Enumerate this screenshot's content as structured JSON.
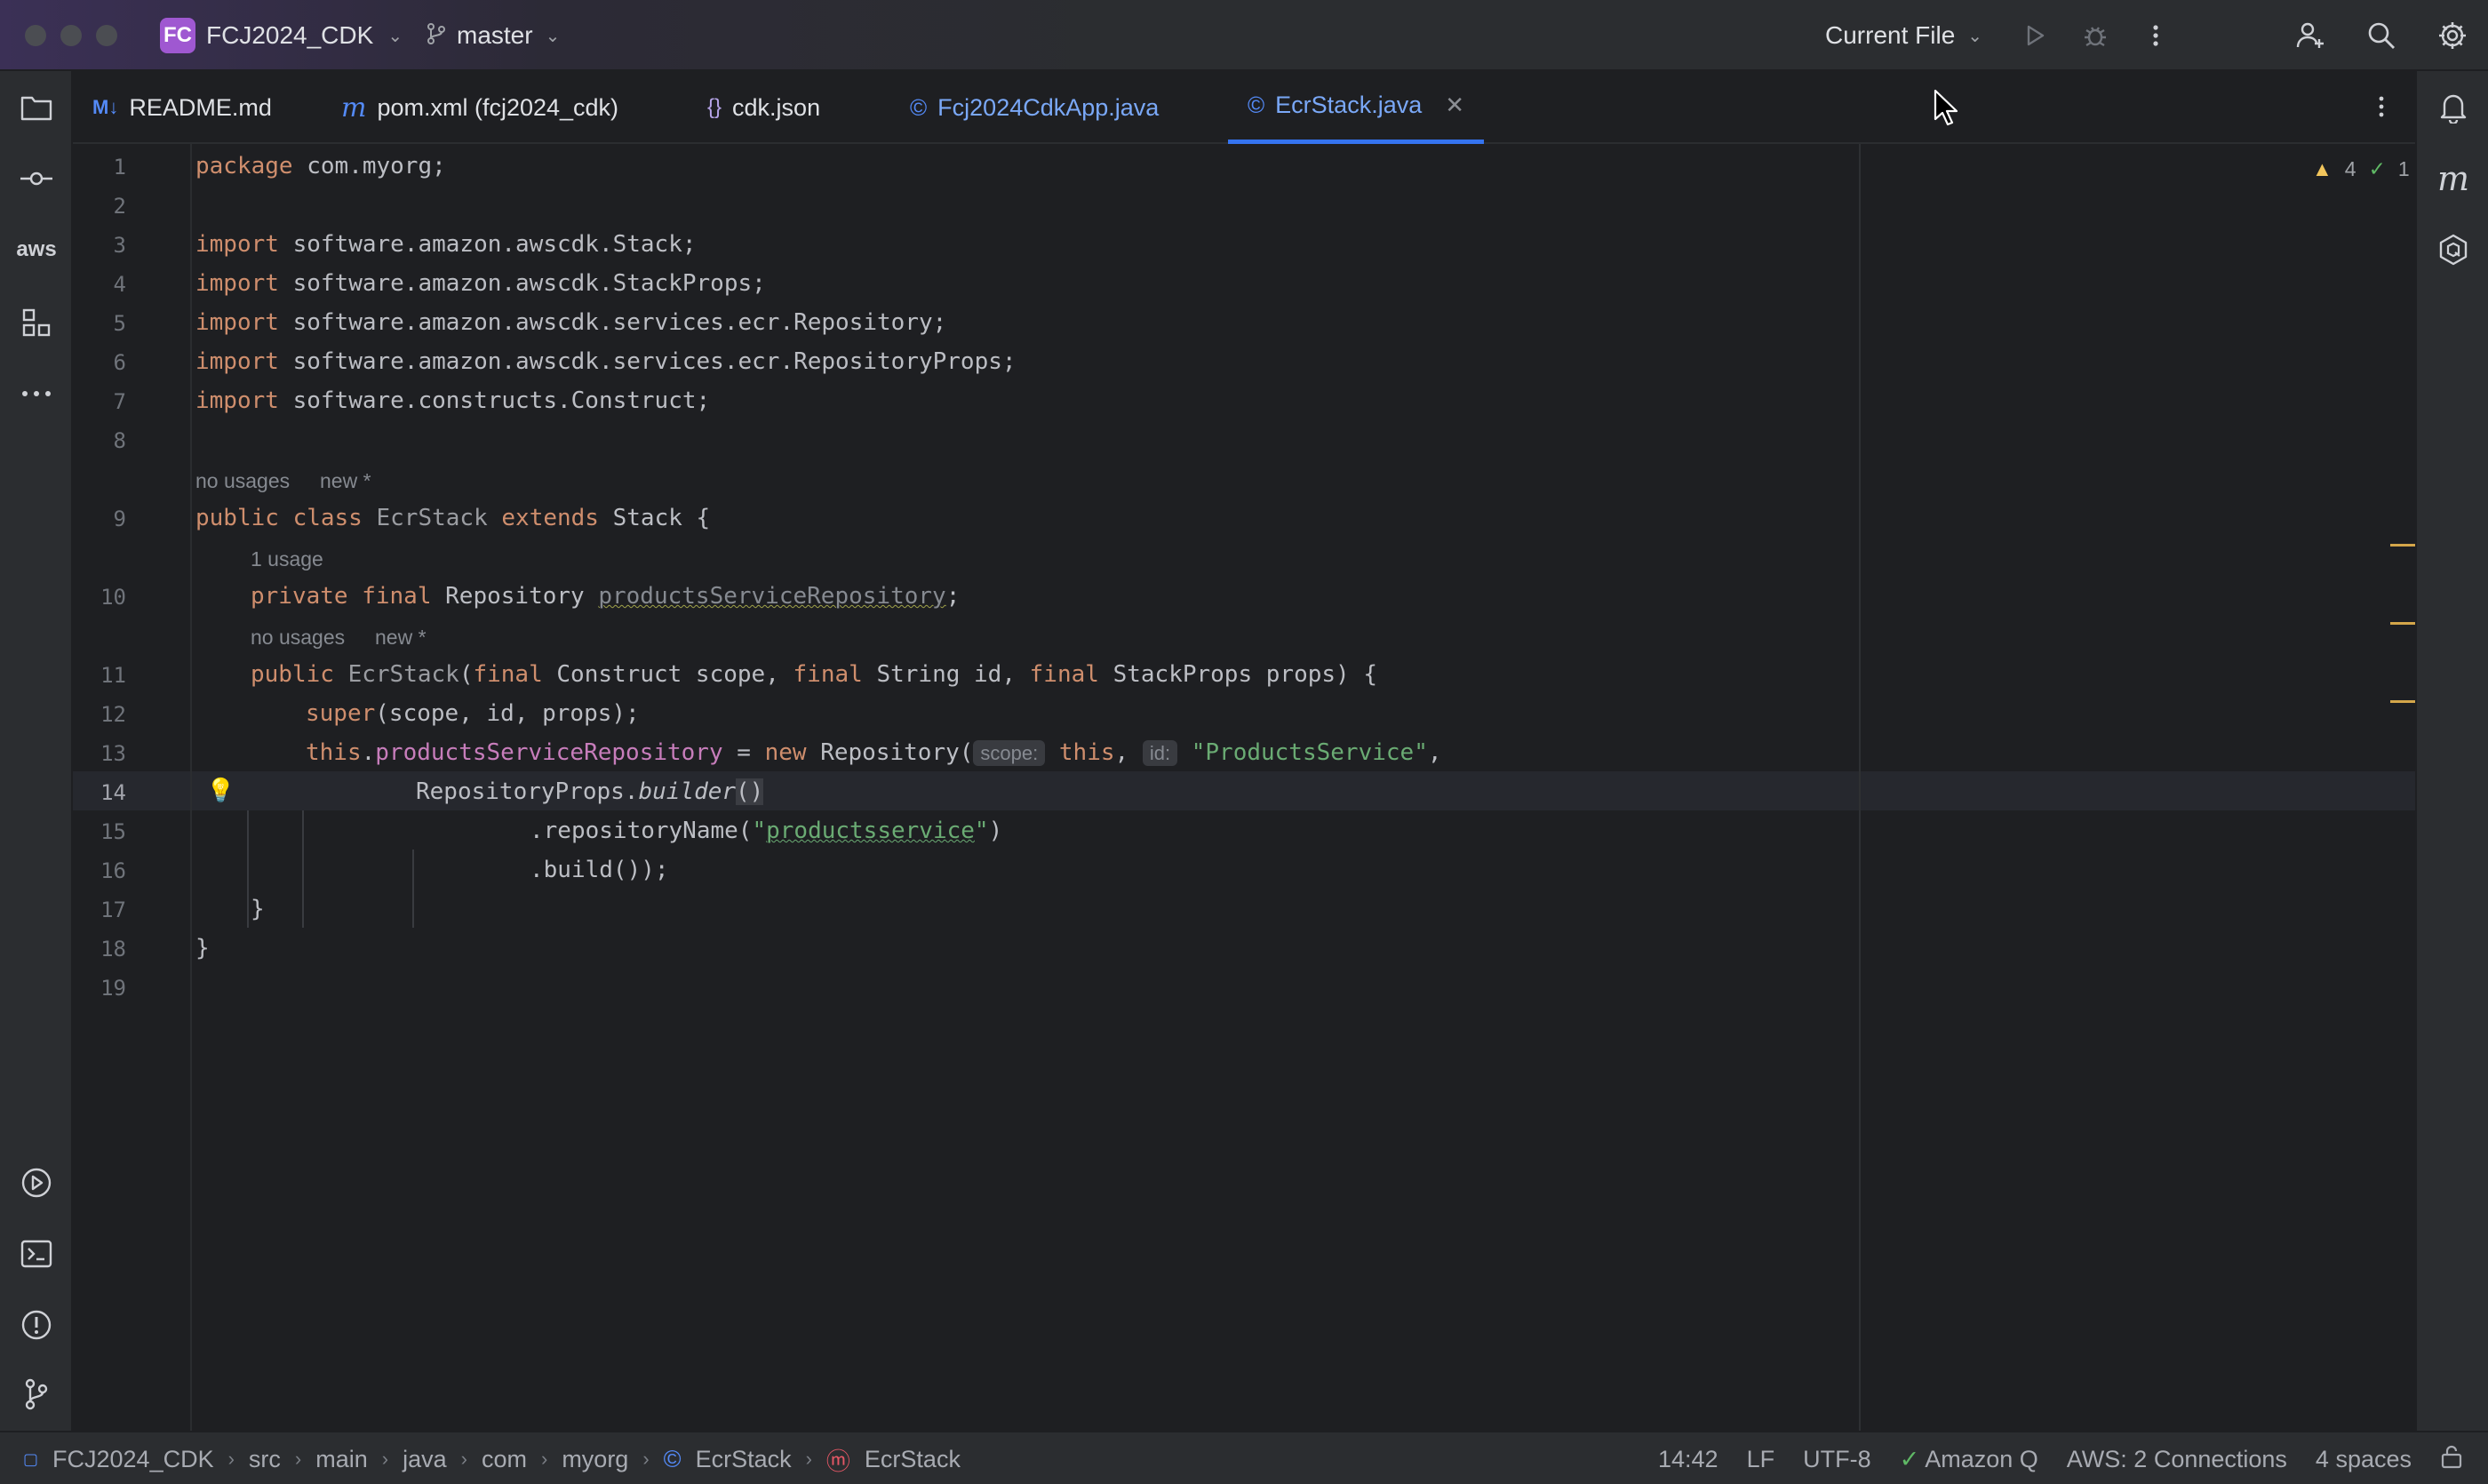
{
  "titlebar": {
    "project_badge": "FC",
    "project_name": "FCJ2024_CDK",
    "branch": "master",
    "run_config": "Current File",
    "icons": [
      "play-icon",
      "debug-icon",
      "more-vertical-icon",
      "add-user-icon",
      "search-icon",
      "settings-gear-icon"
    ]
  },
  "tabs": [
    {
      "label": "README.md",
      "icon": "markdown-icon",
      "icon_text": "M↓"
    },
    {
      "label": "pom.xml (fcj2024_cdk)",
      "icon": "maven-icon",
      "icon_text": "m"
    },
    {
      "label": "cdk.json",
      "icon": "json-icon",
      "icon_text": "{}"
    },
    {
      "label": "Fcj2024CdkApp.java",
      "icon": "class-icon",
      "icon_text": "©"
    },
    {
      "label": "EcrStack.java",
      "icon": "class-icon",
      "icon_text": "©",
      "active": true
    }
  ],
  "editor": {
    "line_numbers": [
      "1",
      "2",
      "3",
      "4",
      "5",
      "6",
      "7",
      "8",
      "9",
      "10",
      "11",
      "12",
      "13",
      "14",
      "15",
      "16",
      "17",
      "18",
      "19"
    ],
    "current_line": "14",
    "hints": {
      "class_usages": "no usages",
      "class_new": "new *",
      "field_usages": "1 usage",
      "ctor_usages": "no usages",
      "ctor_new": "new *"
    },
    "inlay": {
      "scope": "scope:",
      "id": "id:"
    },
    "inspections": {
      "warnings": "4",
      "ok": "1"
    }
  },
  "code": {
    "l1_kw": "package",
    "l1_rest": " com.myorg;",
    "l3_kw": "import",
    "l3_rest": " software.amazon.awscdk.Stack;",
    "l4_kw": "import",
    "l4_rest": " software.amazon.awscdk.StackProps;",
    "l5_kw": "import",
    "l5_rest": " software.amazon.awscdk.services.ecr.Repository;",
    "l6_kw": "import",
    "l6_rest": " software.amazon.awscdk.services.ecr.RepositoryProps;",
    "l7_kw": "import",
    "l7_rest": " software.constructs.Construct;",
    "l9_kw1": "public class",
    "l9_name": " EcrStack",
    "l9_kw2": " extends",
    "l9_rest": " Stack {",
    "l10_kw": "private final",
    "l10_type": " Repository ",
    "l10_field": "productsServiceRepository",
    "l10_end": ";",
    "l11_kw": "public",
    "l11_name": " EcrStack",
    "l11_p1": "(",
    "l11_kw2": "final",
    "l11_p2": " Construct scope, ",
    "l11_kw3": "final",
    "l11_p3": " String id, ",
    "l11_kw4": "final",
    "l11_p4": " StackProps props) {",
    "l12_kw": "super",
    "l12_rest": "(scope, id, props);",
    "l13_kw": "this",
    "l13_dot": ".",
    "l13_field": "productsServiceRepository",
    "l13_eq": " = ",
    "l13_kw2": "new",
    "l13_cls": " Repository(",
    "l13_kw3": "this",
    "l13_comma": ", ",
    "l13_str": "\"ProductsService\"",
    "l13_end": ",",
    "l14_a": "RepositoryProps.",
    "l14_b": "builder",
    "l14_c": "()",
    "l15_a": ".repositoryName(",
    "l15_q1": "\"",
    "l15_str": "productsservice",
    "l15_q2": "\"",
    "l15_c": ")",
    "l16": ".build());",
    "l17": "}",
    "l18": "}"
  },
  "left_strip": [
    "project-folder-icon",
    "commit-icon",
    "aws-icon",
    "structure-icon",
    "more-horizontal-icon",
    "run-services-icon",
    "terminal-icon",
    "problems-icon",
    "git-icon"
  ],
  "left_strip_aws_text": "aws",
  "right_strip": [
    "notifications-bell-icon",
    "maven-panel-icon",
    "amazon-q-icon"
  ],
  "right_strip_maven_text": "m",
  "statusbar": {
    "breadcrumbs": [
      "FCJ2024_CDK",
      "src",
      "main",
      "java",
      "com",
      "myorg",
      "EcrStack",
      "EcrStack"
    ],
    "position": "14:42",
    "line_sep": "LF",
    "encoding": "UTF-8",
    "amazon_q": "Amazon Q",
    "aws": "AWS: 2 Connections",
    "indent": "4 spaces"
  }
}
